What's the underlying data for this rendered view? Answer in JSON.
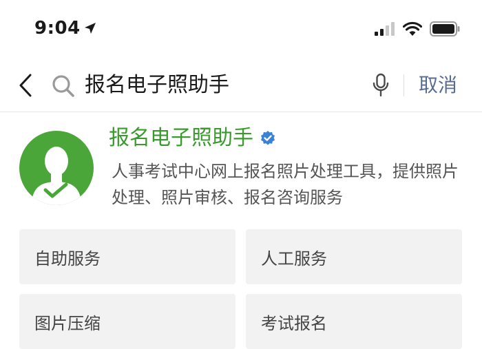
{
  "status_bar": {
    "time": "9:04",
    "icons": [
      "location-arrow-icon",
      "signal-icon",
      "wifi-icon",
      "battery-icon"
    ]
  },
  "search": {
    "query": "报名电子照助手",
    "cancel_label": "取消",
    "icons": [
      "back-chevron-icon",
      "search-icon",
      "microphone-icon"
    ]
  },
  "account": {
    "name": "报名电子照助手",
    "verified": true,
    "description": "人事考试中心网上报名照片处理工具，提供照片处理、照片审核、报名咨询服务",
    "avatar_icon": "person-check-avatar-icon"
  },
  "services": [
    {
      "label": "自助服务"
    },
    {
      "label": "人工服务"
    },
    {
      "label": "图片压缩"
    },
    {
      "label": "考试报名"
    }
  ],
  "colors": {
    "accent_green": "#3a9a2e",
    "avatar_green": "#4ba63a",
    "link_blue": "#576b95",
    "verified_blue": "#3b82d6",
    "button_bg": "#f2f2f2"
  }
}
